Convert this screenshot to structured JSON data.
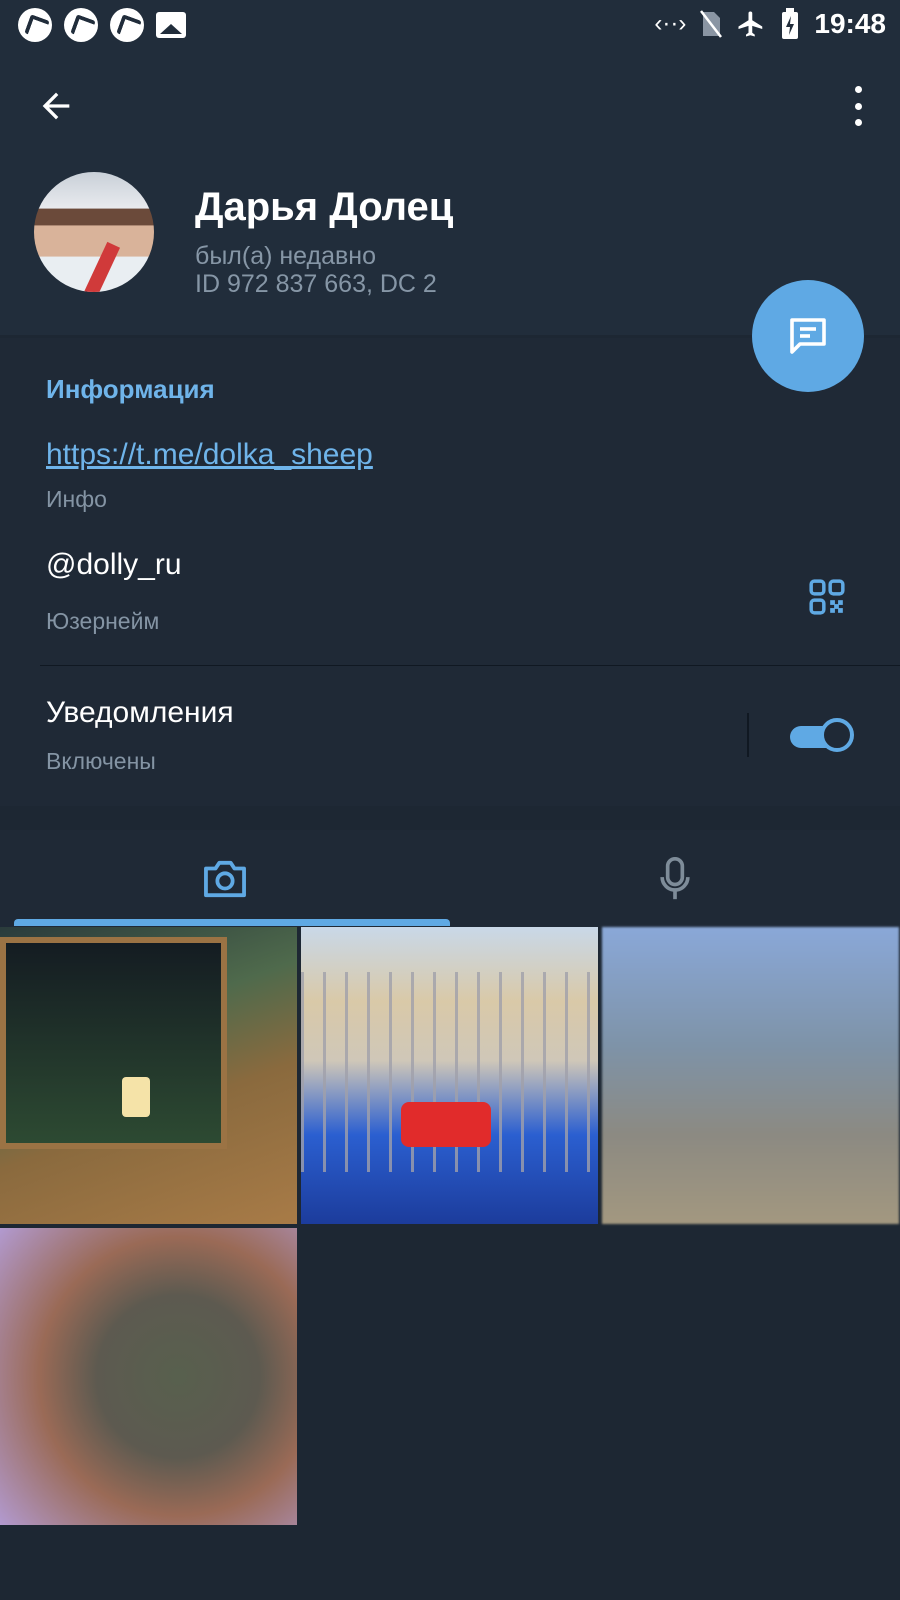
{
  "status_bar": {
    "time": "19:48",
    "left_icons": [
      "app-notification-icon",
      "app-notification-icon",
      "app-notification-icon",
      "image-icon"
    ],
    "right_icons": [
      "data-transfer-icon",
      "no-sim-icon",
      "airplane-mode-icon",
      "battery-charging-icon"
    ]
  },
  "header": {
    "back_icon": "arrow-left-icon",
    "menu_icon": "more-vertical-icon",
    "name": "Дарья Долец",
    "status": "был(а) недавно",
    "id_line": "ID 972 837 663, DC 2",
    "fab_icon": "message-icon"
  },
  "info": {
    "section_title": "Информация",
    "link": "https://t.me/dolka_sheep",
    "link_label": "Инфо",
    "username": "@dolly_ru",
    "username_label": "Юзернейм",
    "notifications": "Уведомления",
    "notifications_state": "Включены",
    "notifications_on": true
  },
  "tabs": {
    "items": [
      "camera-icon",
      "microphone-icon"
    ],
    "active": 0
  },
  "media": {
    "items": [
      "photo",
      "photo",
      "photo",
      "photo"
    ]
  },
  "colors": {
    "accent": "#5fa9e4",
    "background": "#1d2733",
    "header_bg": "#212d3b",
    "link": "#6fb4ea",
    "secondary_text": "#8696a6"
  }
}
